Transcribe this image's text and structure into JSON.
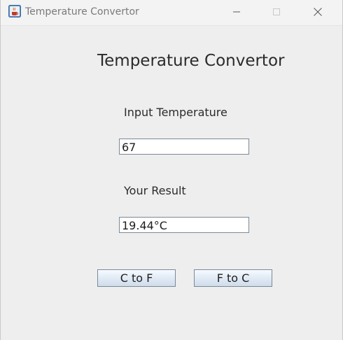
{
  "window": {
    "title": "Temperature Convertor",
    "controls": {
      "minimize_icon": "minimize-icon",
      "maximize_icon": "maximize-icon",
      "close_icon": "close-icon"
    },
    "app_icon": "java-cup-icon"
  },
  "main": {
    "heading": "Temperature Convertor",
    "input_label": "Input Temperature",
    "input_value": "67",
    "result_label": "Your Result",
    "result_value": "19.44°C",
    "buttons": {
      "c_to_f": "C to F",
      "f_to_c": "F to C"
    }
  },
  "colors": {
    "background": "#eeeeee",
    "titlebar": "#f3f3f3",
    "button_gradient_top": "#f7fbff",
    "button_gradient_bottom": "#cfdcea",
    "field_border": "#7a8a99"
  }
}
